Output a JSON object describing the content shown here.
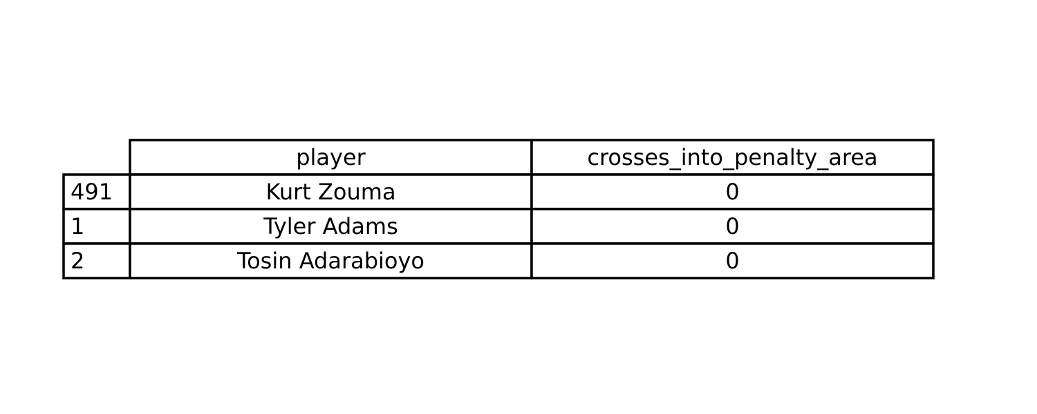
{
  "chart_data": {
    "type": "table",
    "columns": [
      "player",
      "crosses_into_penalty_area"
    ],
    "rows": [
      {
        "index": "491",
        "cells": [
          "Kurt Zouma",
          "0"
        ]
      },
      {
        "index": "1",
        "cells": [
          "Tyler Adams",
          "0"
        ]
      },
      {
        "index": "2",
        "cells": [
          "Tosin Adarabioyo",
          "0"
        ]
      }
    ]
  },
  "colors": {
    "border": "#000000",
    "background": "#ffffff",
    "text": "#000000"
  }
}
